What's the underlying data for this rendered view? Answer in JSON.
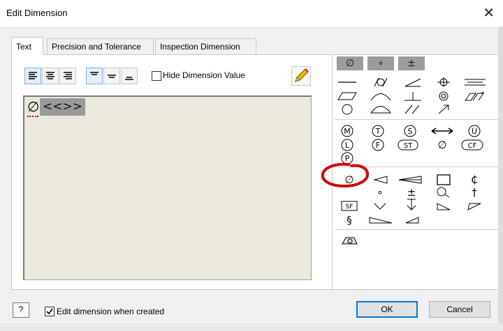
{
  "window": {
    "title": "Edit Dimension",
    "close_glyph": "✕"
  },
  "tabs": [
    {
      "label": "Text",
      "active": true
    },
    {
      "label": "Precision and Tolerance",
      "active": false
    },
    {
      "label": "Inspection Dimension",
      "active": false
    }
  ],
  "toolbar": {
    "hide_dimension_label": "Hide Dimension Value",
    "hide_dimension_checked": false
  },
  "editor": {
    "symbol_text": "∅",
    "placeholder_text": "<<>>"
  },
  "symbol_palette": {
    "header_tabs": [
      "∅",
      "∘",
      "±"
    ],
    "row_text": {
      "modifier_m": "M",
      "modifier_t": "T",
      "modifier_s": "S",
      "modifier_u": "U",
      "modifier_l": "L",
      "modifier_f": "F",
      "modifier_st": "ST",
      "modifier_diameter": "∅",
      "modifier_cf": "CF",
      "modifier_p": "P",
      "diameter": "∅",
      "center_line": "₵",
      "dagger": "†",
      "sf": "SF",
      "section": "§",
      "plusminus": "±",
      "dot": "∘"
    }
  },
  "bottom": {
    "help_label": "?",
    "edit_when_created_label": "Edit dimension when created",
    "edit_when_created_checked": true,
    "ok_label": "OK",
    "cancel_label": "Cancel"
  },
  "colors": {
    "highlight": "#d40000",
    "selection": "#999999",
    "editor_bg": "#ebe9dd",
    "ok_border": "#0078d7"
  }
}
